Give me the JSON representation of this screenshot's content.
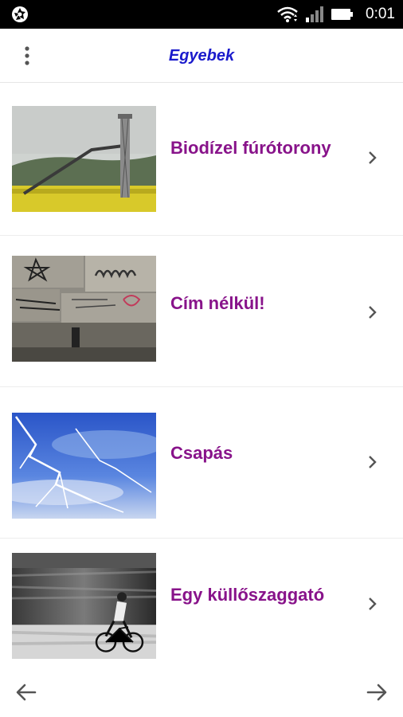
{
  "status_bar": {
    "time": "0:01",
    "icons": [
      "camera-aperture-icon",
      "wifi-icon",
      "cell-signal-icon",
      "battery-icon"
    ]
  },
  "app_bar": {
    "title": "Egyebek",
    "menu_icon": "overflow-menu-icon",
    "title_color": "#1a1acc"
  },
  "items": [
    {
      "label": "Biodízel fúrótorony",
      "image": "oil-drilling-tower-in-rapeseed-field"
    },
    {
      "label": "Cím nélkül!",
      "image": "graffiti-wall"
    },
    {
      "label": "Csapás",
      "image": "lightning-strike"
    },
    {
      "label": "Egy küllőszaggató",
      "image": "cyclist-motion-blur"
    }
  ],
  "item_label_color": "#88138a",
  "bottom_nav": {
    "prev_icon": "arrow-left-icon",
    "next_icon": "arrow-right-icon"
  }
}
